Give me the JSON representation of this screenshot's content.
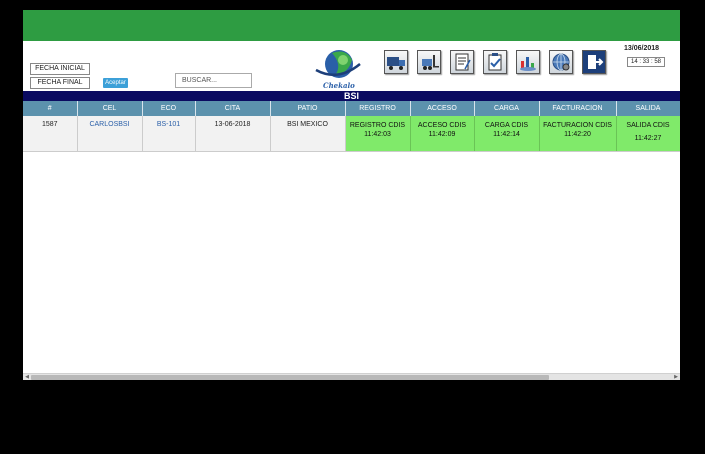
{
  "filters": {
    "fecha_inicial": "FECHA INICIAL",
    "fecha_final": "FECHA FINAL",
    "aceptar": "Aceptar"
  },
  "search": {
    "placeholder": "BUSCAR..."
  },
  "brand": {
    "logo_text": "Chekalo",
    "colors": {
      "topbar": "#2e9c42",
      "banner": "#0a0a60",
      "header": "#5c92ad",
      "ok_cell": "#80ea6a"
    }
  },
  "toolbar": {
    "icons": [
      "truck-icon",
      "forklift-icon",
      "notepad-icon",
      "checklist-icon",
      "chart-icon",
      "globe-gear-icon",
      "exit-icon"
    ]
  },
  "clock": {
    "date": "13/06/2018",
    "time": "14 : 33 : 58"
  },
  "banner": {
    "title": "BSI"
  },
  "table": {
    "headers": [
      "#",
      "CEL",
      "ECO",
      "CITA",
      "PATIO",
      "REGISTRO",
      "ACCESO",
      "CARGA",
      "FACTURACION",
      "SALIDA"
    ],
    "rows": [
      {
        "num": "1587",
        "cel": "CARLOSBSI",
        "eco": "BS-101",
        "cita": "13-06-2018",
        "patio": "BSI MEXICO",
        "registro": {
          "label": "REGISTRO CDIS",
          "time": "11:42:03"
        },
        "acceso": {
          "label": "ACCESO CDIS",
          "time": "11:42:09"
        },
        "carga": {
          "label": "CARGA CDIS",
          "time": "11:42:14"
        },
        "facturacion": {
          "label": "FACTURACION CDIS",
          "time": "11:42:20"
        },
        "salida": {
          "label": "SALIDA CDIS",
          "time": "11:42:27"
        }
      }
    ]
  }
}
